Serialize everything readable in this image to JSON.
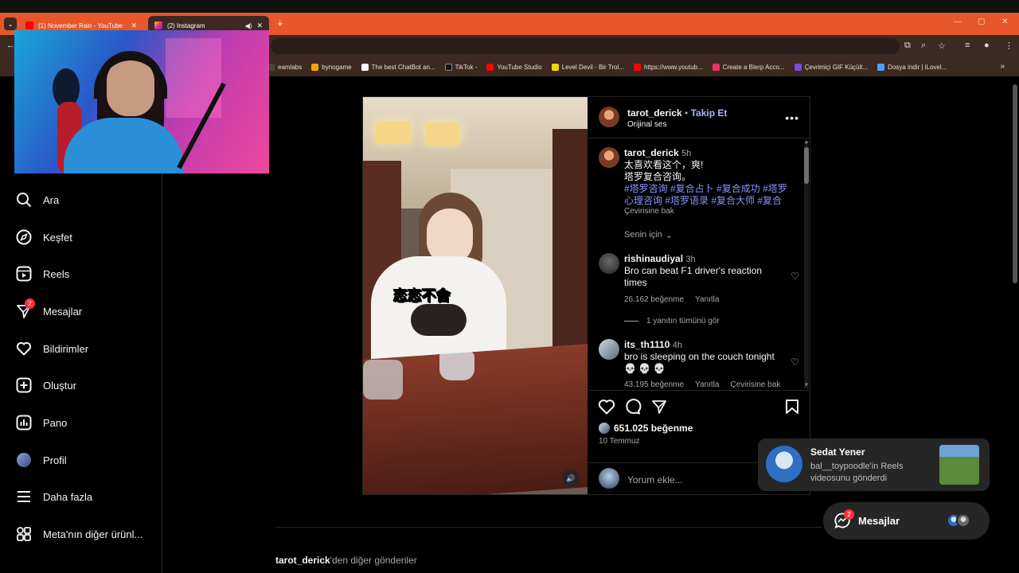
{
  "browser": {
    "tabs": [
      {
        "title": "(1) November Rain - YouTube",
        "active": false,
        "favicon_color": "#ff0000"
      },
      {
        "title": "(2) Instagram",
        "active": true,
        "favicon_color": "#d62976"
      }
    ],
    "new_tab": "+",
    "tab_close": "✕",
    "bookmarks": [
      {
        "label": "eamlabs",
        "color": "#444444"
      },
      {
        "label": "bynogame",
        "color": "#f2a900"
      },
      {
        "label": "The best ChatBot an...",
        "color": "#ffffff"
      },
      {
        "label": "TikTok -",
        "color": "#111111"
      },
      {
        "label": "YouTube Studio",
        "color": "#ff0000"
      },
      {
        "label": "Level Devil - Bir Trol...",
        "color": "#f5d300"
      },
      {
        "label": "https://www.youtub...",
        "color": "#ff0000"
      },
      {
        "label": "Create a Blerp Acco...",
        "color": "#e8336b"
      },
      {
        "label": "Çevrimiçi GIF Küçült...",
        "color": "#7d4cdb"
      },
      {
        "label": "Dosya indir | iLovel...",
        "color": "#4aa3ff"
      }
    ],
    "bookmarks_more": "»"
  },
  "sidebar": {
    "items": [
      {
        "label": "Ara",
        "icon": "search-icon"
      },
      {
        "label": "Keşfet",
        "icon": "compass-icon"
      },
      {
        "label": "Reels",
        "icon": "reels-icon"
      },
      {
        "label": "Mesajlar",
        "icon": "messenger-icon",
        "badge": "2"
      },
      {
        "label": "Bildirimler",
        "icon": "heart-icon"
      },
      {
        "label": "Oluştur",
        "icon": "plus-square-icon"
      },
      {
        "label": "Pano",
        "icon": "dashboard-icon"
      },
      {
        "label": "Profil",
        "icon": "avatar"
      },
      {
        "label": "Daha fazla",
        "icon": "menu-icon"
      },
      {
        "label": "Meta'nın diğer ürünl...",
        "icon": "meta-grid-icon"
      }
    ]
  },
  "post": {
    "video_caption": "恋恋不舍",
    "header": {
      "username": "tarot_derick",
      "separator": "•",
      "follow": "Takip Et",
      "audio": "Orijinal ses",
      "more": "•••"
    },
    "caption": {
      "username": "tarot_derick",
      "time": "5h",
      "line1": "太喜欢看这个，爽!",
      "line2": "塔罗复合咨询。",
      "hashtags": "#塔罗咨询 #复合占卜 #复合成功 #塔罗心理咨询 #塔罗语录 #复合大师 #复合",
      "translate": "Çevirisine bak",
      "for_you": "Senin için",
      "for_you_chevron": "⌄"
    },
    "comments": [
      {
        "username": "rishinaudiyal",
        "time": "3h",
        "text": "Bro can beat F1 driver's reaction times",
        "likes": "26.162 beğenme",
        "reply": "Yanıtla",
        "view_replies": "1 yanıtın tümünü gör"
      },
      {
        "username": "its_th1110",
        "time": "4h",
        "text": "bro is sleeping on the couch tonight",
        "emoji": "💀 💀 💀",
        "likes": "43.195 beğenme",
        "reply": "Yanıtla",
        "translate": "Çevirisine bak"
      }
    ],
    "likes": "651.025 beğenme",
    "date": "10 Temmuz",
    "comment_placeholder": "Yorum ekle..."
  },
  "more_posts": {
    "bold": "tarot_derick",
    "rest": "'den diğer gönderiler"
  },
  "toast": {
    "name": "Sedat Yener",
    "message": "bal__toypoodle'in Reels videosunu gönderdi"
  },
  "messages_pill": {
    "label": "Mesajlar",
    "badge": "2"
  }
}
